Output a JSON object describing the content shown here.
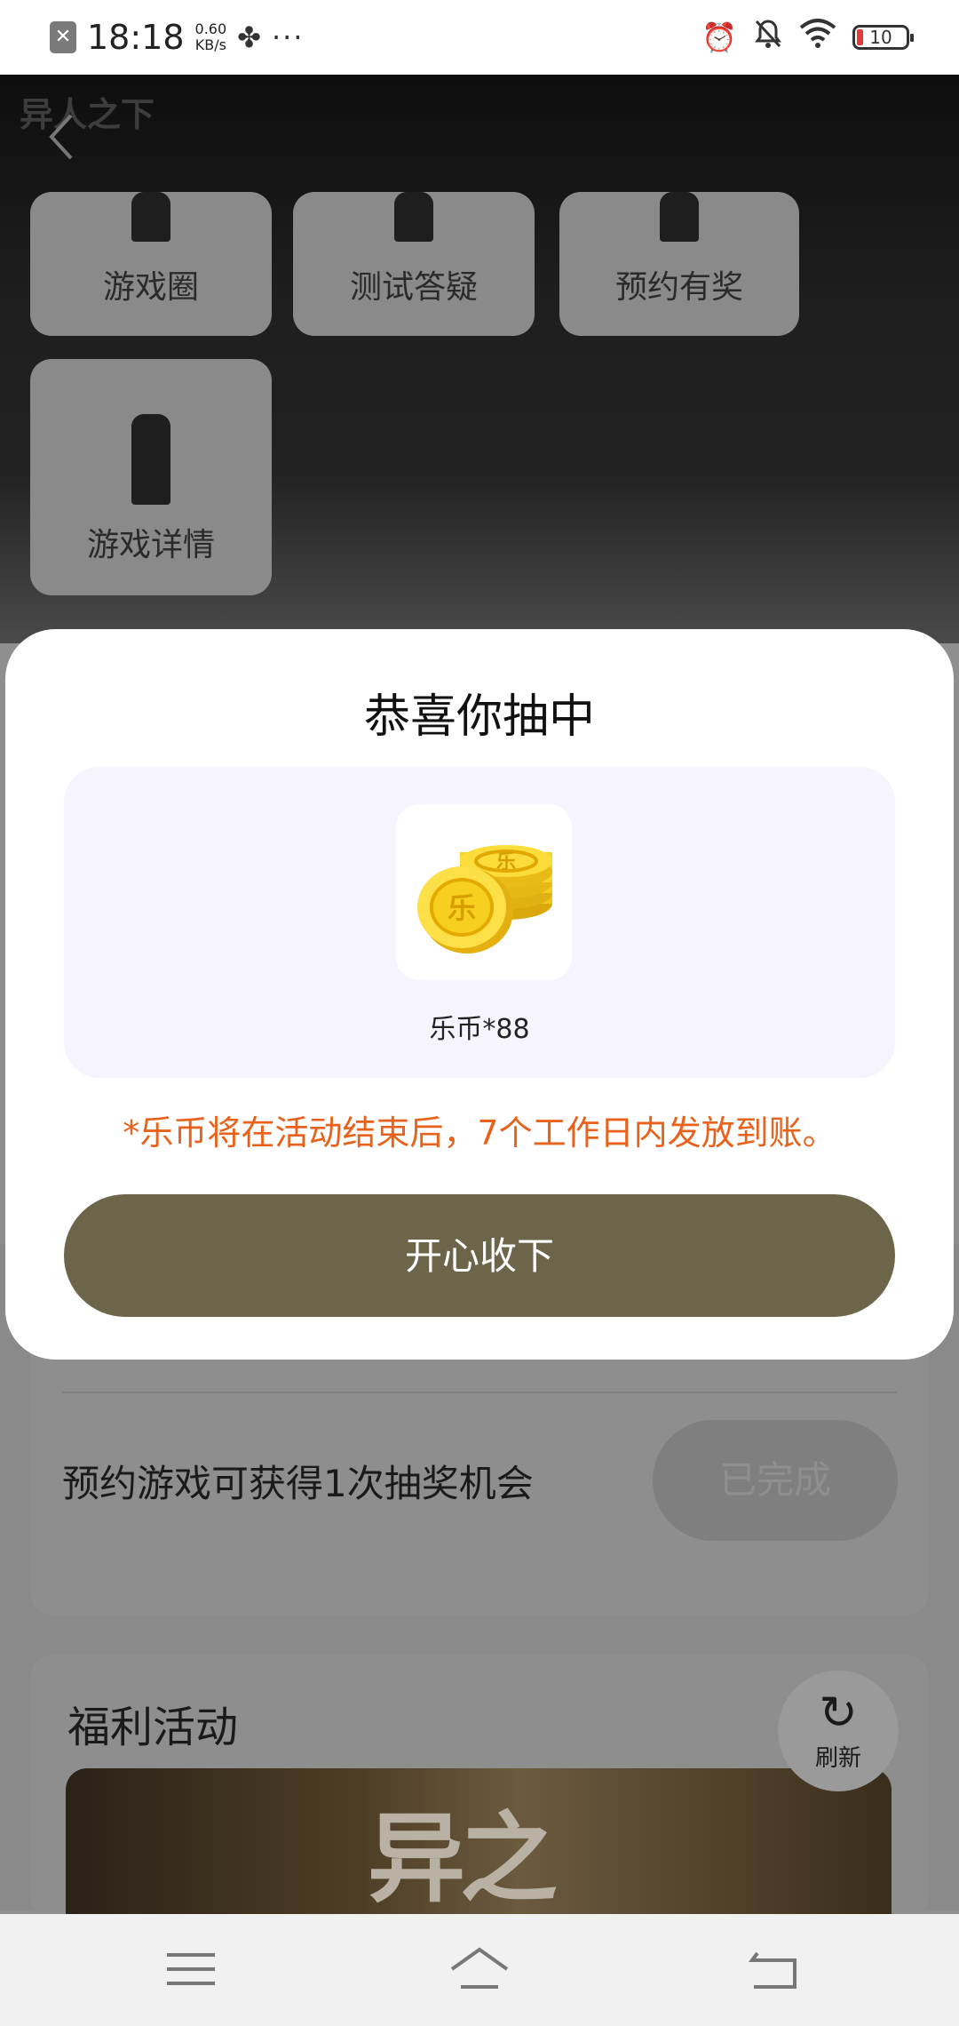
{
  "status_bar": {
    "time": "18:18",
    "net_speed_value": "0.60",
    "net_speed_unit": "KB/s",
    "battery": "10",
    "icons": [
      "notification-x-icon",
      "fan-app-icon",
      "more-dots-icon",
      "alarm-icon",
      "mute-bell-icon",
      "wifi-icon",
      "battery-icon"
    ]
  },
  "header": {
    "logo_text": "异人之下"
  },
  "tiles": [
    {
      "label": "游戏圈"
    },
    {
      "label": "测试答疑"
    },
    {
      "label": "预约有奖"
    },
    {
      "label": "游戏详情"
    }
  ],
  "task": {
    "text": "预约游戏可获得1次抽奖机会",
    "button": "已完成"
  },
  "welfare": {
    "title": "福利活动",
    "banner_text": "异之"
  },
  "refresh": {
    "label": "刷新"
  },
  "modal": {
    "title": "恭喜你抽中",
    "prize_label": "乐币*88",
    "coin_char": "乐",
    "notice": "*乐币将在活动结束后，7个工作日内发放到账。",
    "confirm": "开心收下"
  },
  "colors": {
    "accent_button": "#6d654a",
    "notice": "#e8621c",
    "prize_bg": "#f5f4ff"
  }
}
